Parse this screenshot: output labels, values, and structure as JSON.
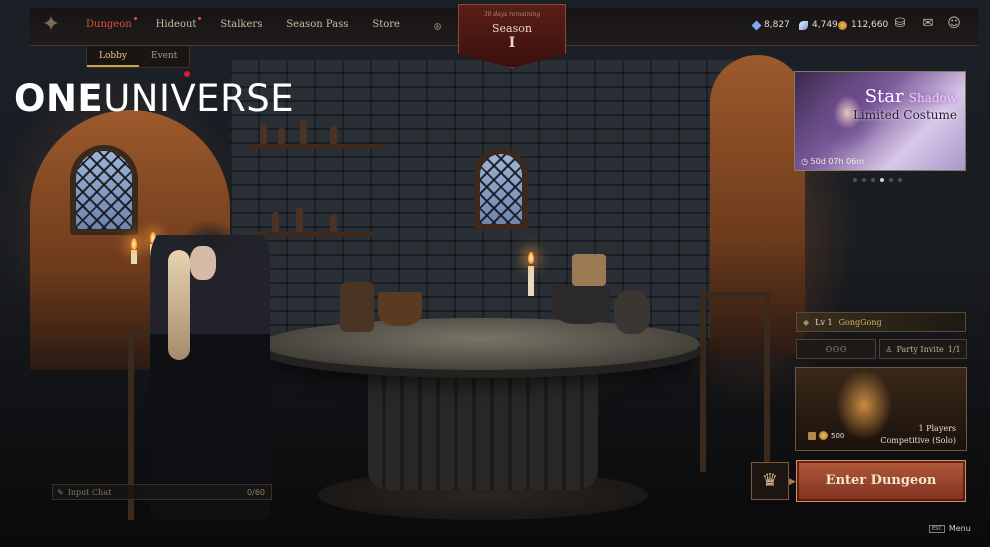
{
  "nav": {
    "items": [
      {
        "label": "Dungeon",
        "active": true,
        "dot": true
      },
      {
        "label": "Hideout",
        "active": false,
        "dot": true
      },
      {
        "label": "Stalkers",
        "active": false,
        "dot": false
      },
      {
        "label": "Season Pass",
        "active": false,
        "dot": false
      },
      {
        "label": "Store",
        "active": false,
        "dot": false
      }
    ],
    "subtabs": [
      {
        "label": "Lobby",
        "active": true
      },
      {
        "label": "Event",
        "active": false
      }
    ]
  },
  "season": {
    "note": "30 days remaining",
    "label": "Season",
    "number": "I"
  },
  "currencies": [
    {
      "icon": "gem-icon",
      "value": "8,827"
    },
    {
      "icon": "feather-icon",
      "value": "4,749"
    },
    {
      "icon": "coin-icon",
      "value": "112,660"
    }
  ],
  "brand": {
    "part1": "ONE",
    "part2": "UNIVERSE"
  },
  "event": {
    "title_part1": "Star",
    "title_part2": "Shadow",
    "subtitle": "Limited Costume",
    "timer": "50d 07h 06m",
    "pages": 6,
    "active_page": 4
  },
  "party": {
    "level": "Lv 1",
    "name": "GongGong",
    "invite_label": "Party Invite",
    "invite_count": "1/1"
  },
  "dungeon": {
    "players": "1 Players",
    "mode": "Competitive (Solo)",
    "cost": "500"
  },
  "enter_label": "Enter Dungeon",
  "chat": {
    "placeholder": "Input Chat",
    "count": "0/60"
  },
  "menu": {
    "key": "ESC",
    "label": "Menu"
  },
  "colors": {
    "accent": "#e0503a",
    "enter_button": "#b25a3a",
    "gold": "#d4b060"
  }
}
